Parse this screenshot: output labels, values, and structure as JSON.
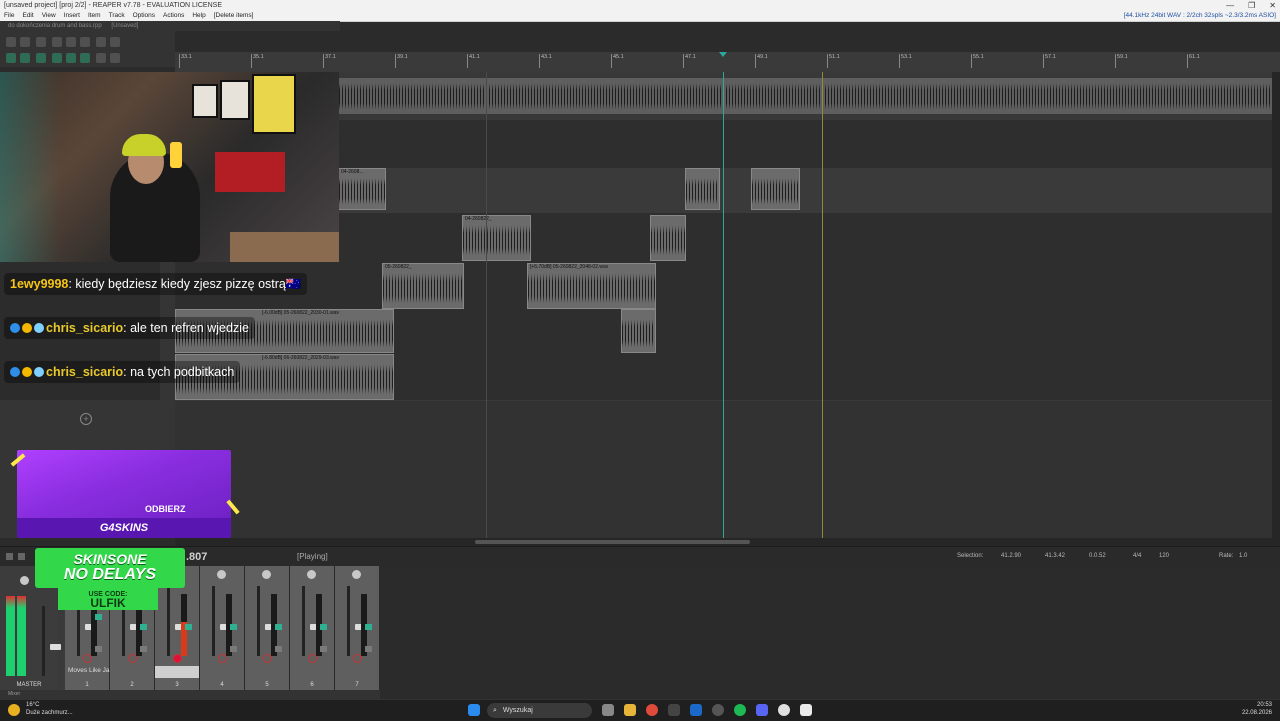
{
  "window": {
    "title": "[unsaved project] [proj 2/2] - REAPER v7.78 - EVALUATION LICENSE",
    "controls": [
      "—",
      "❐",
      "✕"
    ]
  },
  "menu": {
    "items": [
      "File",
      "Edit",
      "View",
      "Insert",
      "Item",
      "Track",
      "Options",
      "Actions",
      "Help",
      "[Delete items]"
    ],
    "format_info": "[44.1kHz 24bit WAV : 2/2ch 32spls ~2.3/3.2ms ASIO]"
  },
  "tabs": {
    "project": "do dokończenia drum and bass.rpp",
    "current": "[Unsaved]"
  },
  "ruler": {
    "ticks": [
      "33.1",
      "35.1",
      "37.1",
      "39.1",
      "41.1",
      "43.1",
      "45.1",
      "47.1",
      "49.1",
      "51.1",
      "53.1",
      "55.1",
      "57.1",
      "59.1",
      "61.1"
    ]
  },
  "clips": [
    {
      "label": "04-2608..."
    },
    {
      "label": "04-260822_"
    },
    {
      "label": "05-260822_"
    },
    {
      "label": "[+5.70dB] 05-260822_2048-02.wav"
    },
    {
      "label": "[-6.00dB] 05-260822_2030-01.wav"
    },
    {
      "label": "[-6.80dB] 06-260822_2029-03.wav"
    }
  ],
  "chat": [
    {
      "user": "1ewy9998",
      "message": "kiedy będziesz kiedy zjesz pizzę ostrą🇦🇺"
    },
    {
      "user": "chris_sicario",
      "message": "ale ten refren wjedzie"
    },
    {
      "user": "chris_sicario",
      "message": "na tych podbitkach"
    }
  ],
  "promo": {
    "cta": "ODBIERZ",
    "brand": "G4SKINS",
    "banner_line1": "SKINSONE",
    "banner_line2": "NO DELAYS",
    "code_label": "USE CODE:",
    "code": "ULFIK"
  },
  "transport": {
    "time": ".807",
    "state": "[Playing]",
    "selection_label": "Selection:",
    "selection_start": "41.2.90",
    "selection_end": "41.3.42",
    "selection_length": "0.0.52",
    "time_sig": "4/4",
    "bpm": "120",
    "rate_label": "Rate:",
    "rate": "1.0"
  },
  "mixer": {
    "master_label": "MASTER",
    "track_name": "Moves Like Ja",
    "track_numbers": [
      "1",
      "2",
      "3",
      "4",
      "5",
      "6",
      "7"
    ],
    "mixer_tab": "Mixer"
  },
  "taskbar": {
    "temp": "16°C",
    "weather": "Duże zachmurz...",
    "search_placeholder": "Wyszukaj",
    "time": "20:53",
    "date": "22.08.2026"
  },
  "colors": {
    "accent_green": "#32d84a",
    "promo_purple": "#8a2ee0",
    "playhead": "#2aa89a"
  }
}
